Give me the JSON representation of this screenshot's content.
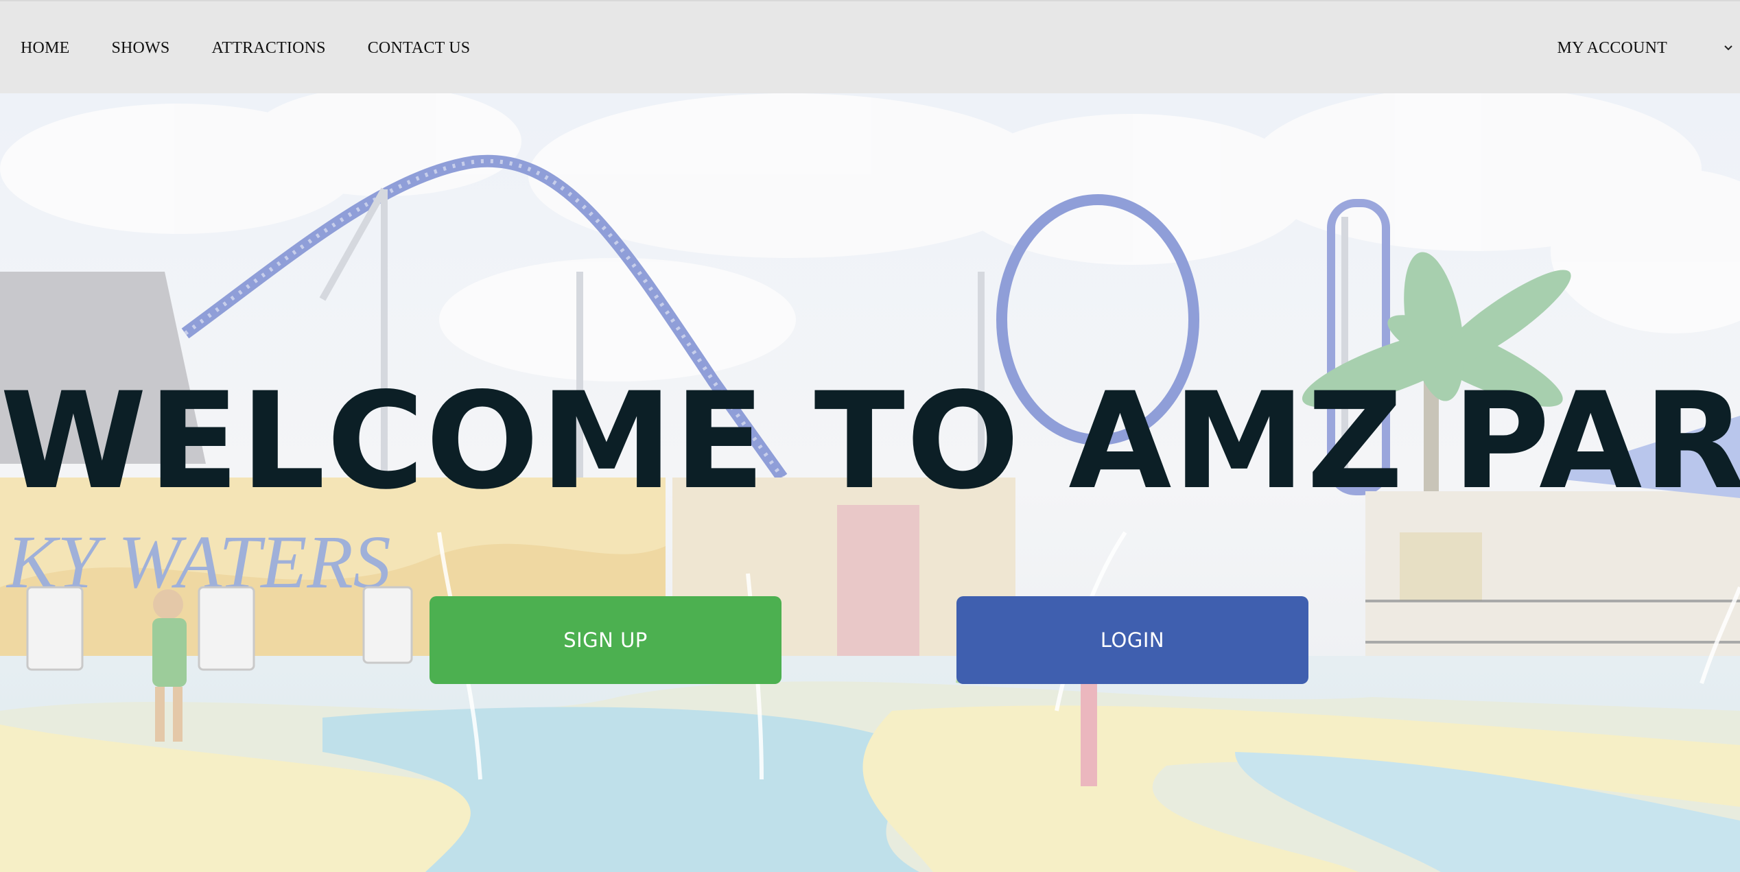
{
  "nav": {
    "links": [
      "HOME",
      "SHOWS",
      "ATTRACTIONS",
      "CONTACT US"
    ],
    "account_label": "MY ACCOUNT",
    "account_icon": "chevron-down-icon"
  },
  "hero": {
    "title": "WELCOME TO AMZ PARK",
    "signup_label": "SIGN UP",
    "login_label": "LOGIN",
    "colors": {
      "title": "#0c1f26",
      "signup": "#4cb050",
      "login": "#3f5faf",
      "nav_background": "#e7e7e7"
    }
  }
}
